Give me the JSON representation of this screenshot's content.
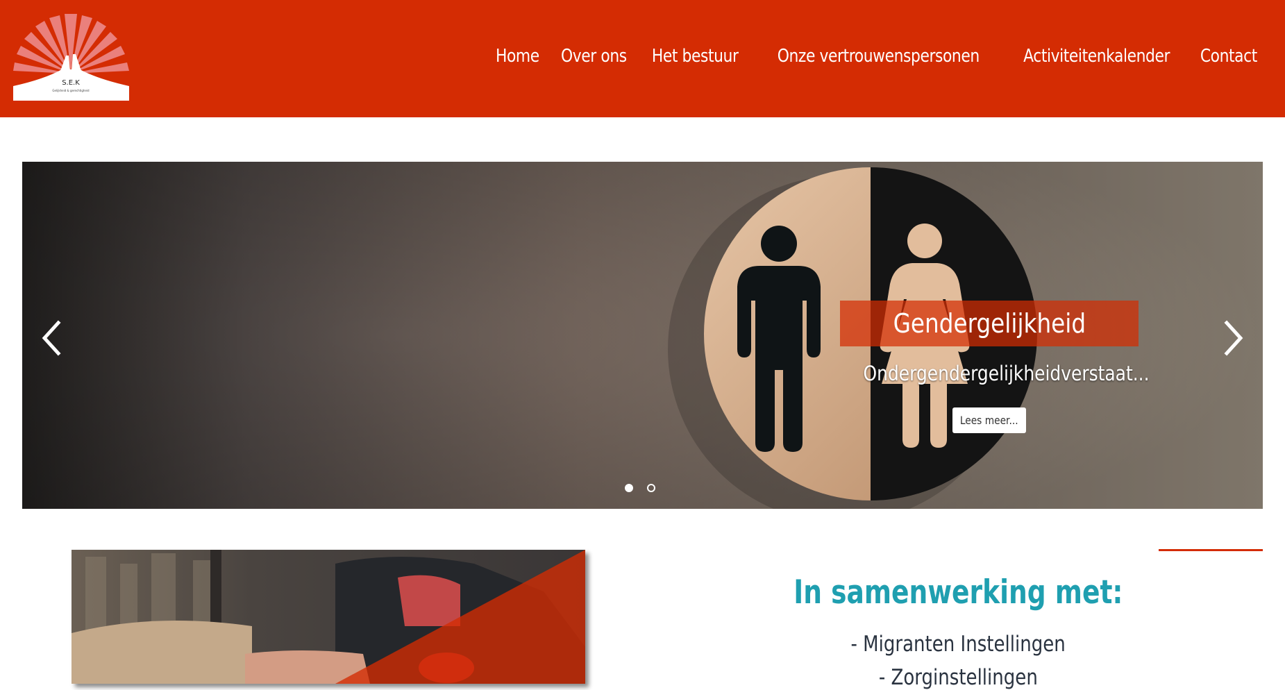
{
  "logo": {
    "text": "S.E.K",
    "subtext": "Gelijkheid & gerechtigheid"
  },
  "nav": {
    "items": [
      "Home",
      "Over ons",
      "Het bestuur",
      "Onze vertrouwenspersonen",
      "Activiteitenkalender",
      "Contact"
    ]
  },
  "carousel": {
    "slide_title": "Gendergelijkheid",
    "slide_text": "Ondergendergelijkheidverstaat...",
    "button_label": "Lees meer...",
    "slide_count": 2,
    "active_slide": 1,
    "prev_icon": "chevron-left-icon",
    "next_icon": "chevron-right-icon"
  },
  "collaboration": {
    "title": "In samenwerking met:",
    "partners": [
      "- Migranten Instellingen",
      "- Zorginstellingen"
    ]
  },
  "colors": {
    "brand": "#d42c03",
    "accent": "#1f9fb0",
    "text": "#2a3340"
  }
}
